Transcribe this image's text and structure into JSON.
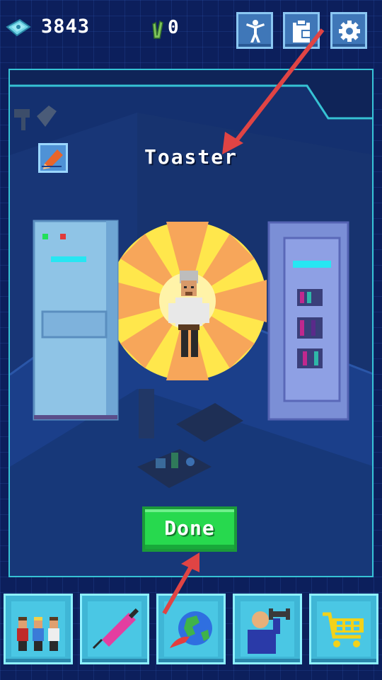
{
  "hud": {
    "cash_value": "3843",
    "seeds_value": "0",
    "icons": [
      "cash-icon",
      "seed-icon",
      "person-icon",
      "clipboard-icon",
      "gear-icon"
    ]
  },
  "panel": {
    "item_title": "Toaster",
    "edit_icon": "pencil-icon"
  },
  "done_label": "Done",
  "bottom_nav": [
    {
      "name": "staff-icon"
    },
    {
      "name": "syringe-icon"
    },
    {
      "name": "globe-rocket-icon"
    },
    {
      "name": "trainer-icon"
    },
    {
      "name": "shopping-cart-icon"
    }
  ],
  "colors": {
    "background": "#0c1f5c",
    "panel_border": "#36c2d4",
    "done_button": "#27d94e",
    "arrow": "#e04444"
  }
}
